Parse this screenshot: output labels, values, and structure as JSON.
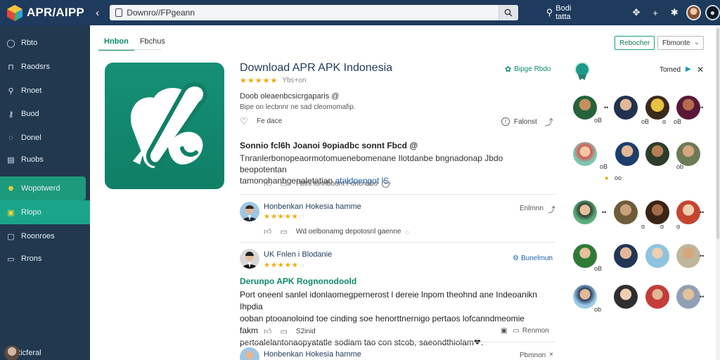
{
  "topbar": {
    "logo_text": "APR/AIPP",
    "address_text": "Downro//FPgeann",
    "search_link": "Bodi tatta",
    "icons": [
      "back-icon",
      "search-icon",
      "bug-icon",
      "plus-icon",
      "settings-icon",
      "avatar",
      "user-icon"
    ]
  },
  "sidebar": {
    "items": [
      {
        "label": "Rbto",
        "icon": "home-icon"
      },
      {
        "label": "Raodsrs",
        "icon": "library-icon"
      },
      {
        "label": "Rnoet",
        "icon": "search-icon"
      },
      {
        "label": "Buod",
        "icon": "key-icon"
      },
      {
        "label": "Donel",
        "icon": "chat-icon"
      },
      {
        "label": "Ruobs",
        "icon": "list-icon"
      },
      {
        "label": "Wopotwerd",
        "icon": "smile-icon"
      },
      {
        "label": "Rlopo",
        "icon": "grid-icon"
      },
      {
        "label": "Roonroes",
        "icon": "box-icon"
      },
      {
        "label": "Rrons",
        "icon": "note-icon"
      }
    ],
    "footer_name": "Rnoticferal"
  },
  "main": {
    "tabs": [
      "Hnbon",
      "Fbchus"
    ],
    "action_button": "Rebocher",
    "select_value": "Fbmonte",
    "app": {
      "title": "Download APR APK Indonesia",
      "stars": "★★★★★",
      "rating_label": "Ybs+on",
      "desc1": "Doob oleaenbcsicrgaparis @",
      "desc2": "Bipe on lecbnnr ne sad cleomomafip.",
      "favorite_label": "Fe dace",
      "report_label": "Falonst"
    },
    "top_badge": "Bipge Rbdo",
    "post": {
      "title": "Sonnio fcl6h Joanoi  9opiadbc sonnt Fbcd @",
      "body_line1": "Tnranlerbonopeaormotomuenebomenane  Ilotdanbe bngnadonap Jbdo beopotentan",
      "body_line2_prefix": "tamonohanbgenaletatian ",
      "body_link": "ataldoengot lS.",
      "meta": "Fbtnl  lonnboont Foncnabo"
    },
    "comments": [
      {
        "name": "Honbenkan Hokesia hamme",
        "stars": "★★★★★",
        "date": "Enlmnn",
        "meta": "Wd  oelbonamg depotosnl gaenne"
      },
      {
        "name": "UK Fnlen i Blodanie",
        "stars": "★★★★★",
        "verify": "Bunelmun",
        "heading": "Derunpo APK  Rognonodoold",
        "body1": "Port oneenl sanlel idonlaomegpernerost l dereie lnpom theohnd ane Indeoanikn Ihpdia",
        "body2": "ooban ptooanoloind toe cinding soe henorttnernigo  pertaos lofcanndmeomie fakm",
        "body3": "pertoalelantonaopyatatle sodiam tao con stcob, saeondthiolam❤.",
        "likes": "S2inid",
        "report": "Renmon"
      },
      {
        "name": "Honbenkan Hokesia hamme",
        "date": "Pbmnon"
      }
    ]
  },
  "right_panel": {
    "trend_label": "Tomed",
    "tags": [
      "oB",
      "oB",
      "oB",
      "oB",
      "oo",
      "ob",
      "oB",
      "ob"
    ]
  }
}
